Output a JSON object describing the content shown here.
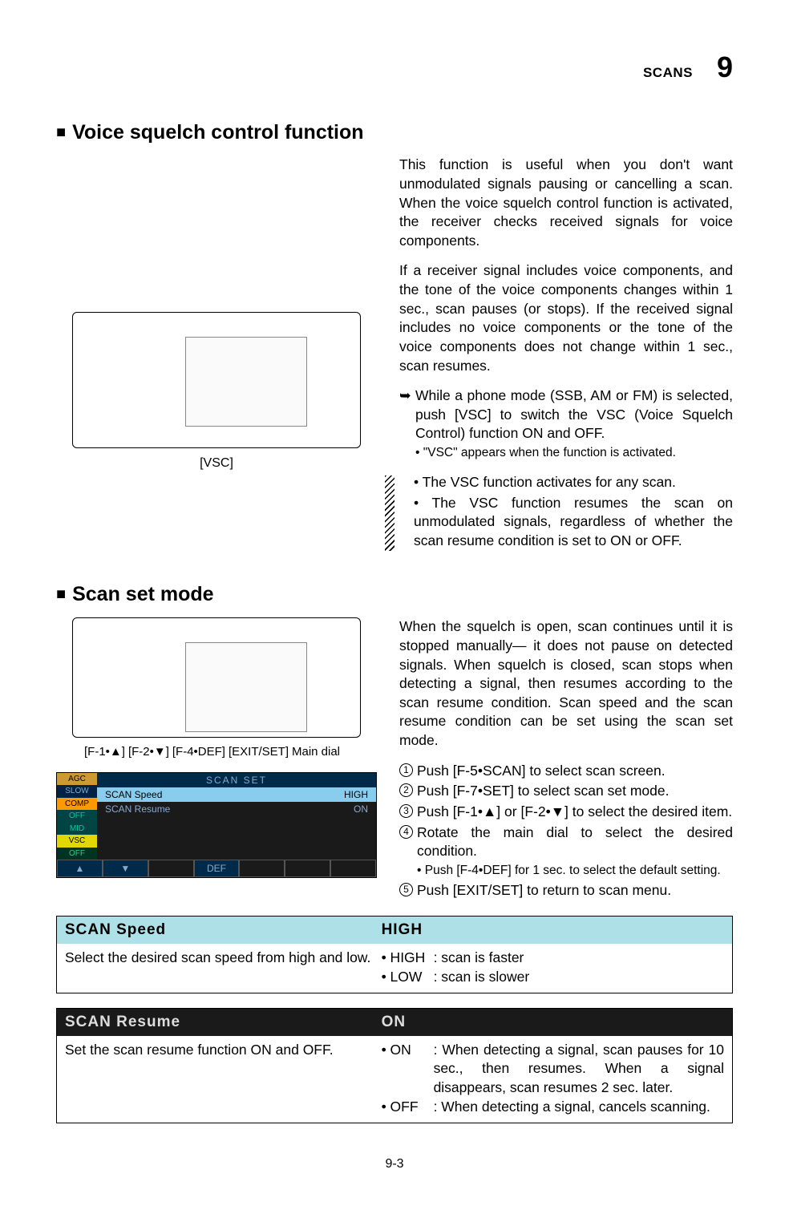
{
  "header": {
    "label": "SCANS",
    "chapter": "9"
  },
  "section1": {
    "title": "Voice squelch control function",
    "p1": "This function is useful when you don't want unmodulated signals pausing or cancelling a scan. When the voice squelch control function is activated, the receiver checks received signals for voice components.",
    "p2": "If a receiver signal includes voice components, and the tone of the voice components changes within 1 sec., scan pauses (or stops). If the received signal includes no voice components or the tone of the voice components does not change within 1 sec., scan resumes.",
    "arrow_text": "While a phone mode (SSB, AM or FM) is selected, push [VSC] to switch the VSC (Voice Squelch Control) function ON and OFF.",
    "arrow_sub": "• \"VSC\" appears when the function is activated.",
    "hatch1": "• The VSC function activates for any scan.",
    "hatch2": "• The VSC function resumes the scan on unmodulated signals, regardless of whether the scan resume condition is set to ON or OFF.",
    "caption": "[VSC]"
  },
  "section2": {
    "title": "Scan set mode",
    "p1": "When the squelch is open, scan continues until it is stopped manually— it does not pause on detected signals. When squelch is closed, scan stops when detecting a signal, then resumes according to the scan resume condition. Scan speed and the scan resume condition can be set using the scan set mode.",
    "step1": "Push [F-5•SCAN] to select scan screen.",
    "step2": "Push [F-7•SET] to select scan set mode.",
    "step3": "Push [F-1•▲] or [F-2•▼] to select the desired item.",
    "step4": "Rotate the main dial to select the desired condition.",
    "step4_sub": "• Push [F-4•DEF] for 1 sec. to select the default setting.",
    "step5": "Push [EXIT/SET] to return to scan menu.",
    "fn_labels": {
      "f1": "[F-1•▲]",
      "f2": "[F-2•▼]",
      "f4": "[F-4•DEF]",
      "exit": "[EXIT/SET]",
      "main": "Main dial"
    },
    "lcd": {
      "agc": "AGC",
      "agc_sub": "SLOW",
      "comp": "COMP",
      "comp_sub_off": "OFF",
      "comp_sub_mid": "MID",
      "vsc": "VSC",
      "vsc_sub": "OFF",
      "title": "SCAN  SET",
      "row1_l": "SCAN  Speed",
      "row1_r": "HIGH",
      "row2_l": "SCAN  Resume",
      "row2_r": "ON",
      "fn_up": "▲",
      "fn_dn": "▼",
      "fn_def": "DEF"
    }
  },
  "opt1": {
    "head_l": "SCAN  Speed",
    "head_r": "HIGH",
    "desc": "Select the desired scan speed from high and low.",
    "high_tag": "• HIGH",
    "high_val": ": scan is faster",
    "low_tag": "• LOW",
    "low_val": ": scan is slower"
  },
  "opt2": {
    "head_l": "SCAN  Resume",
    "head_r": "ON",
    "desc": "Set the scan resume function ON and OFF.",
    "on_tag": "• ON",
    "on_val": ": When detecting a signal, scan pauses for 10 sec., then resumes. When a signal disappears, scan resumes 2 sec. later.",
    "off_tag": "• OFF",
    "off_val": ": When detecting a signal, cancels scanning."
  },
  "page_num": "9-3"
}
